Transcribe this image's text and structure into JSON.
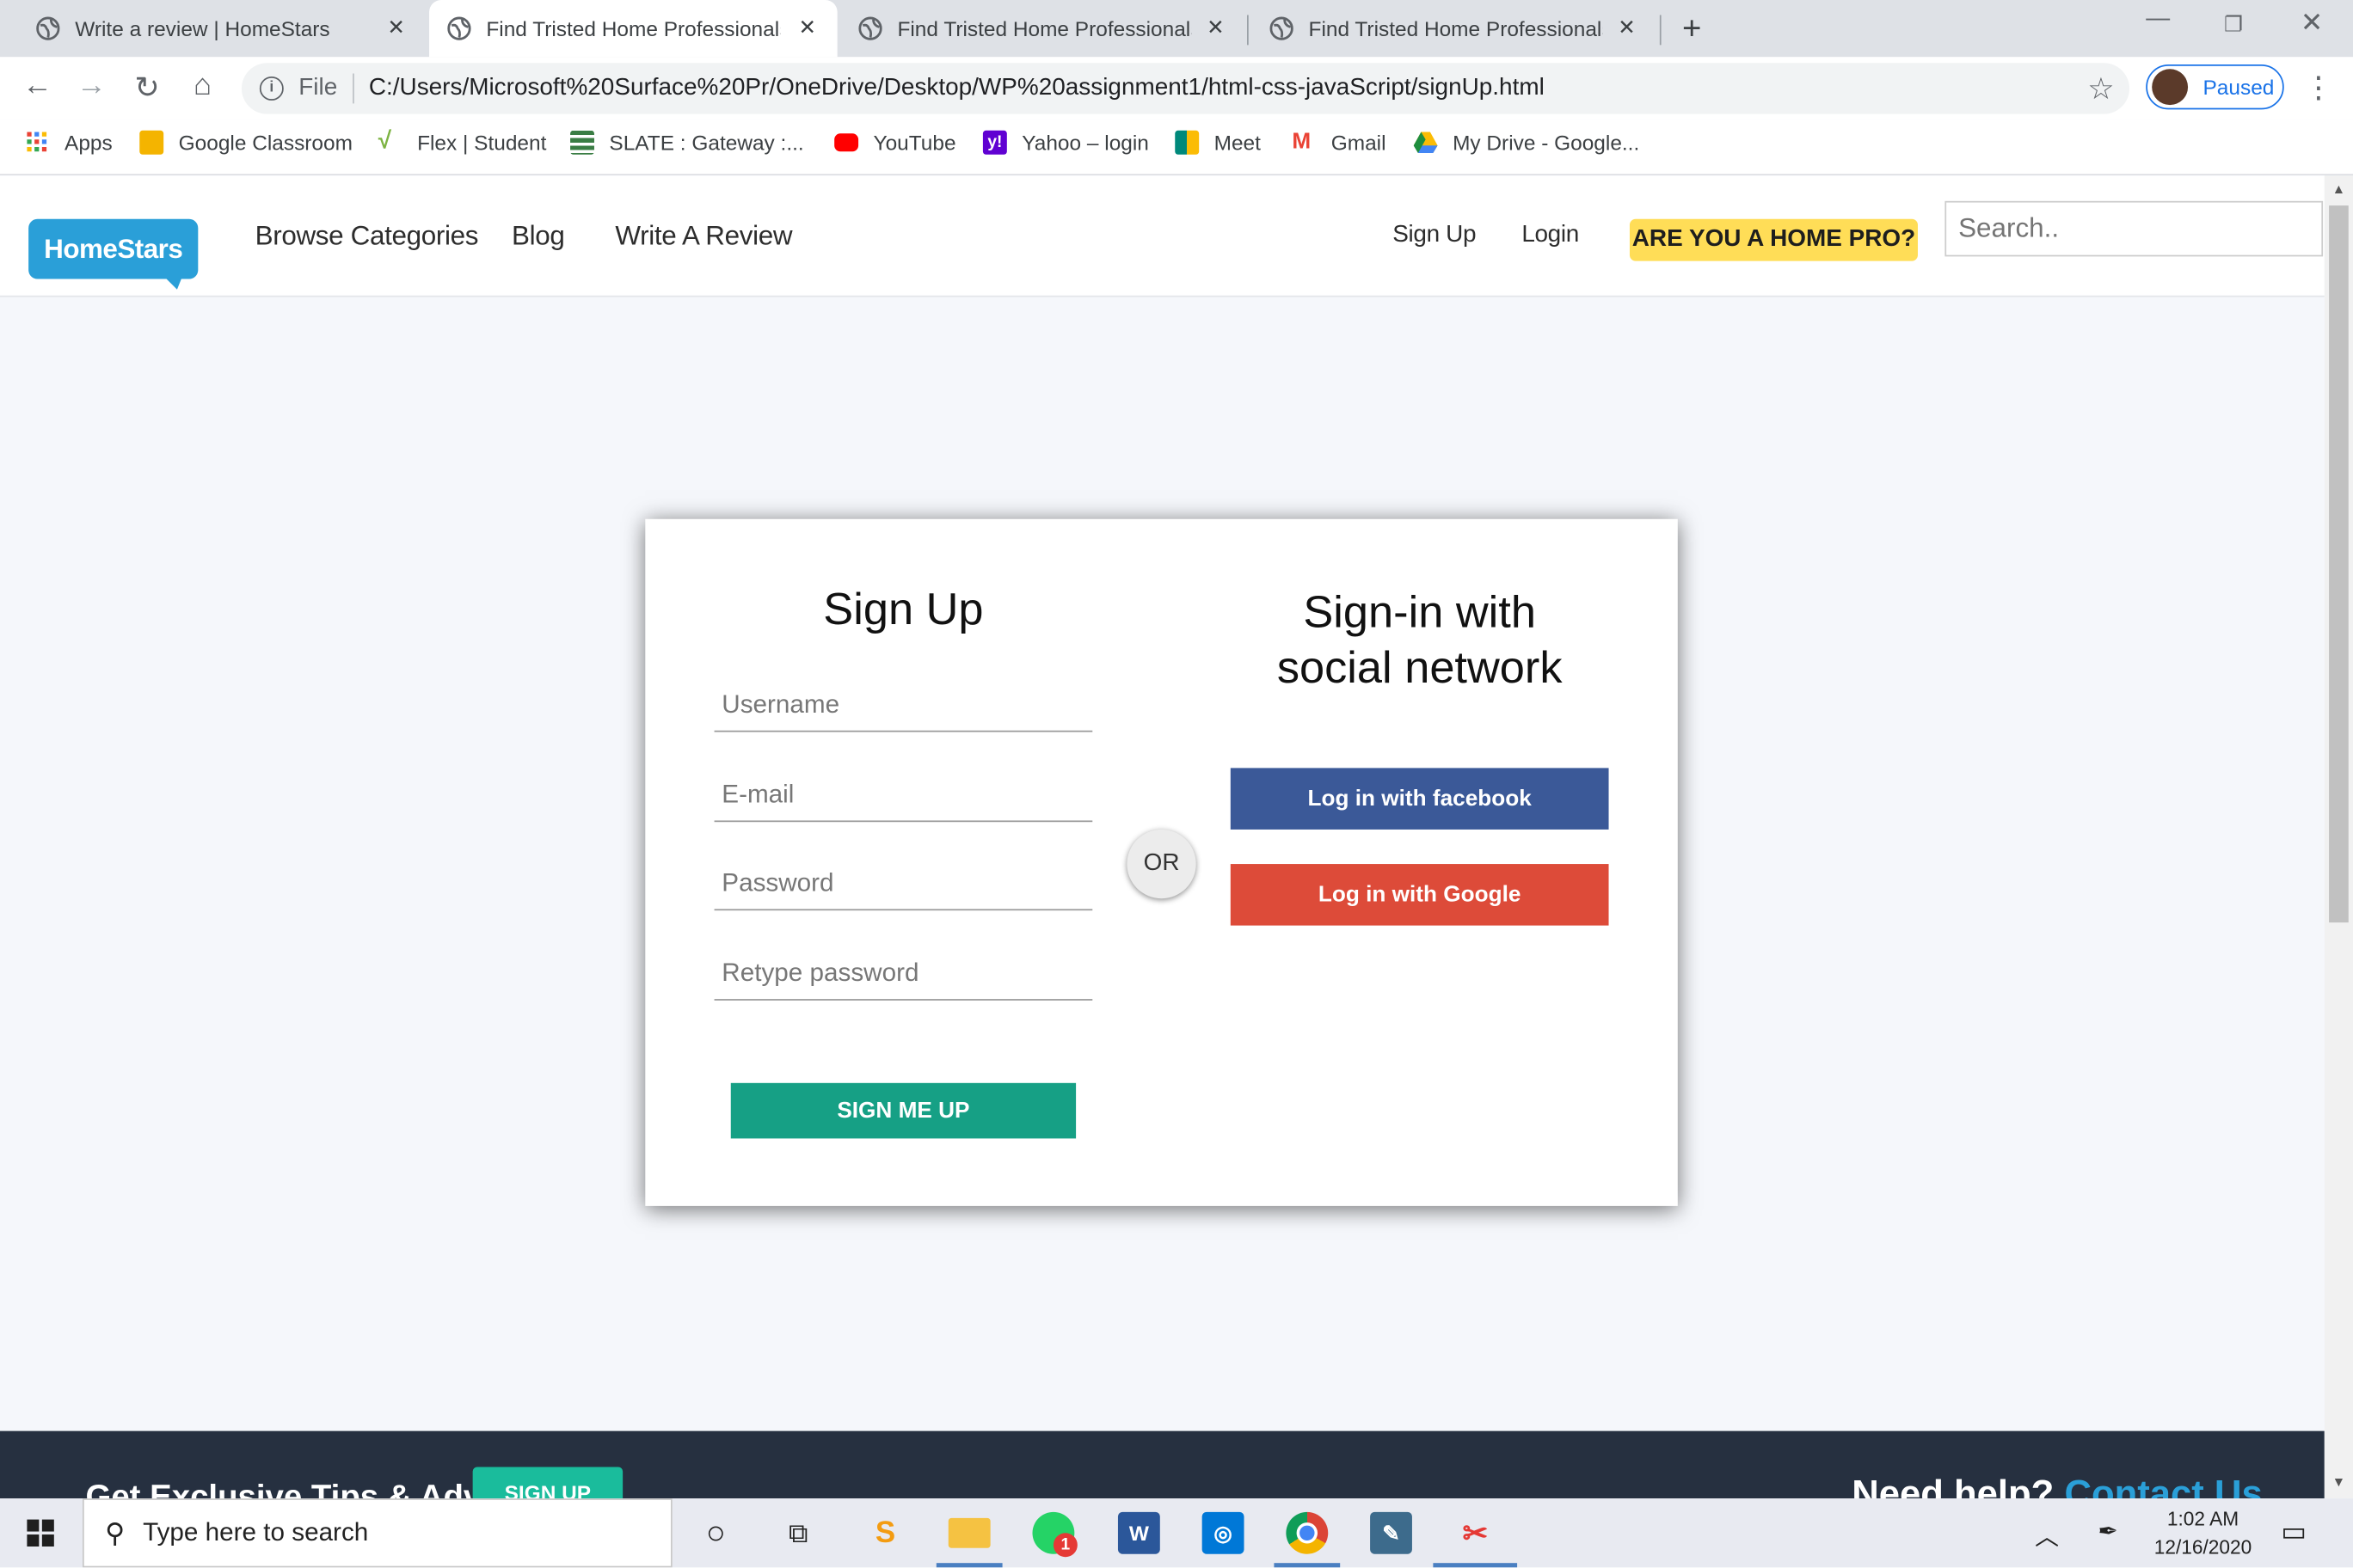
{
  "browser": {
    "tabs": [
      {
        "title": "Write a review | HomeStars",
        "active": false
      },
      {
        "title": "Find Tristed Home Professionals",
        "active": true
      },
      {
        "title": "Find Tristed Home Professionals",
        "active": false
      },
      {
        "title": "Find Tristed Home Professionals",
        "active": false
      }
    ],
    "new_tab": "+",
    "address": {
      "scheme_label": "File",
      "url": "C:/Users/Microsoft%20Surface%20Pr/OneDrive/Desktop/WP%20assignment1/html-css-javaScript/signUp.html"
    },
    "profile_label": "Paused",
    "bookmarks": [
      {
        "label": "Apps",
        "icon": "apps-grid-icon",
        "color": "#4285f4"
      },
      {
        "label": "Google Classroom",
        "icon": "classroom-icon",
        "color": "#f4b400"
      },
      {
        "label": "Flex | Student",
        "icon": "flex-icon",
        "color": "#7cb342"
      },
      {
        "label": "SLATE : Gateway :...",
        "icon": "slate-icon",
        "color": "#3a7d44"
      },
      {
        "label": "YouTube",
        "icon": "youtube-icon",
        "color": "#ff0000"
      },
      {
        "label": "Yahoo – login",
        "icon": "yahoo-icon",
        "color": "#6001d2"
      },
      {
        "label": "Meet",
        "icon": "meet-icon",
        "color": "#00897b"
      },
      {
        "label": "Gmail",
        "icon": "gmail-icon",
        "color": "#ea4335"
      },
      {
        "label": "My Drive - Google...",
        "icon": "drive-icon",
        "color": "#1e8e3e"
      }
    ]
  },
  "site": {
    "logo": "HomeStars",
    "nav": {
      "browse": "Browse Categories",
      "blog": "Blog",
      "review": "Write A Review",
      "signup": "Sign Up",
      "login": "Login",
      "pro": "ARE YOU A HOME PRO?"
    },
    "search_placeholder": "Search.."
  },
  "form": {
    "title": "Sign Up",
    "username_placeholder": "Username",
    "email_placeholder": "E-mail",
    "password_placeholder": "Password",
    "retype_placeholder": "Retype password",
    "submit": "SIGN ME UP",
    "or": "OR",
    "social_title_line1": "Sign-in with",
    "social_title_line2": "social network",
    "facebook": "Log in with facebook",
    "google": "Log in with Google"
  },
  "footer": {
    "tips": "Get Exclusive Tips & Advice",
    "tips_button": "SIGN UP",
    "help": "Need help?",
    "contact": "Contact Us"
  },
  "taskbar": {
    "search_placeholder": "Type here to search",
    "time": "1:02 AM",
    "date": "12/16/2020",
    "whatsapp_badge": "1"
  },
  "colors": {
    "brand": "#2a9fd8",
    "pro": "#ffdd57",
    "facebook": "#3b5998",
    "google": "#dd4b39",
    "signup": "#16a085",
    "footer": "#263040"
  }
}
